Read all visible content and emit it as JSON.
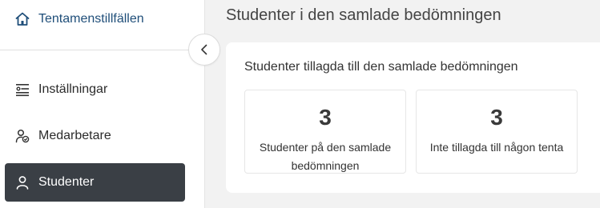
{
  "sidebar": {
    "brand": {
      "label": "Tentamenstillfällen",
      "icon": "home-icon"
    },
    "collapse": {
      "icon": "chevron-left-icon"
    },
    "items": [
      {
        "label": "Inställningar",
        "icon": "settings-list-icon",
        "active": false
      },
      {
        "label": "Medarbetare",
        "icon": "user-check-icon",
        "active": false
      },
      {
        "label": "Studenter",
        "icon": "user-icon",
        "active": true
      }
    ]
  },
  "main": {
    "title": "Studenter i den samlade bedömningen",
    "panel": {
      "title": "Studenter tillagda till den samlade bedömningen",
      "stats": [
        {
          "value": "3",
          "label": "Studenter på den samlade bedömningen"
        },
        {
          "value": "3",
          "label": "Inte tillagda till någon tenta"
        }
      ]
    }
  },
  "colors": {
    "brand_text": "#1f4e79",
    "active_nav_bg": "#3a3f45",
    "page_bg": "#f2f2f2"
  }
}
